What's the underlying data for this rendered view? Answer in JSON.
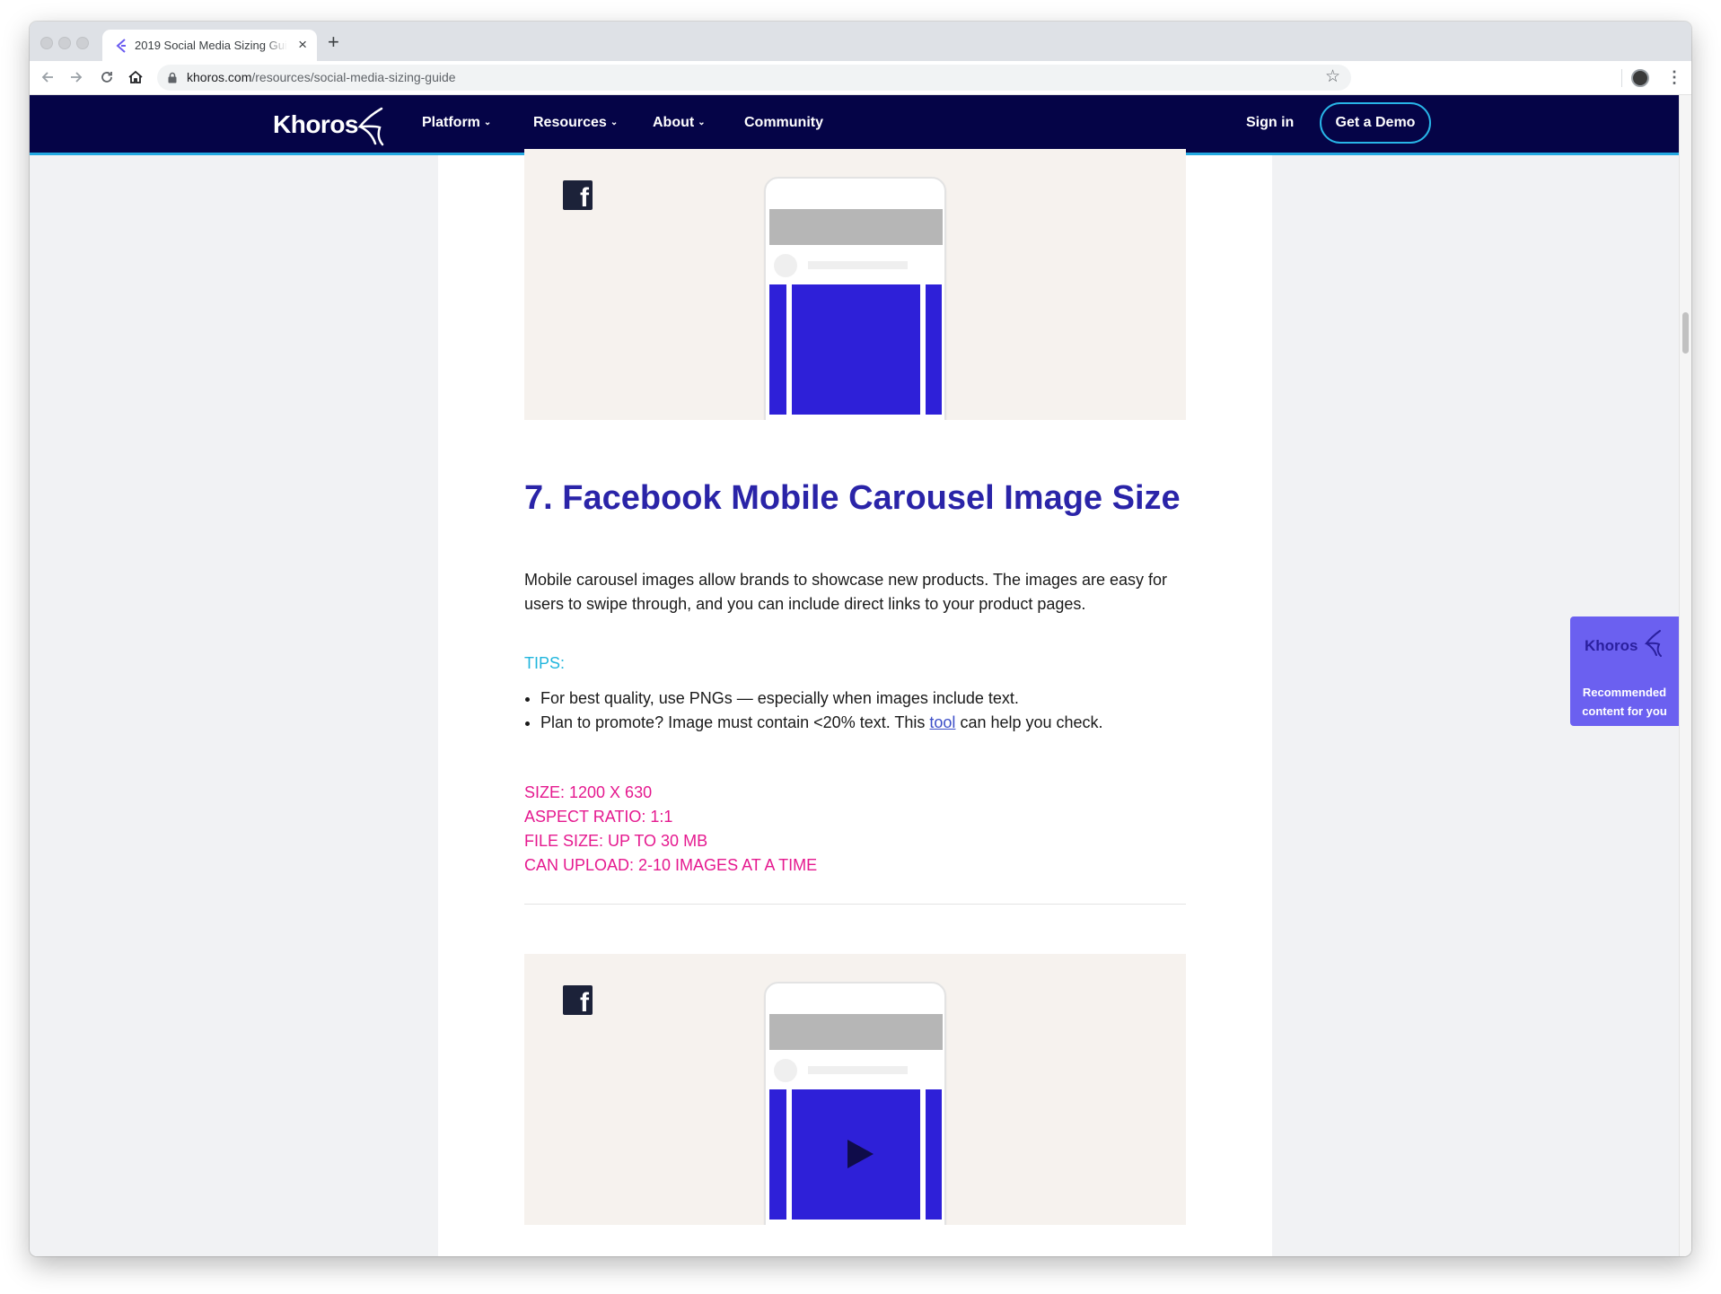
{
  "browser": {
    "tab_title": "2019 Social Media Sizing Guide",
    "tab_close": "×",
    "new_tab": "+",
    "url_domain": "khoros.com",
    "url_path": "/resources/social-media-sizing-guide"
  },
  "nav": {
    "brand": "Khoros",
    "items": [
      {
        "label": "Platform"
      },
      {
        "label": "Resources"
      },
      {
        "label": "About"
      },
      {
        "label": "Community"
      }
    ],
    "sign_in": "Sign in",
    "cta": "Get a Demo"
  },
  "article": {
    "heading": "7. Facebook Mobile Carousel Image Size",
    "intro": "Mobile carousel images allow brands to showcase new products. The images are easy for users to swipe through, and you can include direct links to your product pages.",
    "tips_label": "TIPS:",
    "tips": {
      "tip1": "For best quality, use PNGs — especially when images include text.",
      "tip2_before": "Plan to promote? Image must contain <20% text. This ",
      "tip2_link": "tool",
      "tip2_after": " can help you check."
    },
    "specs": [
      "SIZE: 1200 X 630",
      "ASPECT RATIO: 1:1",
      "FILE SIZE: UP TO 30 MB",
      "CAN UPLOAD: 2-10 IMAGES AT A TIME"
    ]
  },
  "widget": {
    "brand": "Khoros",
    "line1": "Recommended",
    "line2": "content for you"
  },
  "colors": {
    "nav_bg": "#050447",
    "heading": "#2a24a8",
    "tips": "#21b6dd",
    "specs": "#e5198f",
    "phone_media": "#2e20d8",
    "widget_bg": "#6b60f0"
  },
  "icons": [
    "back-icon",
    "forward-icon",
    "reload-icon",
    "home-icon",
    "lock-icon",
    "star-icon",
    "profile-icon",
    "menu-icon",
    "facebook-icon",
    "play-icon",
    "chevron-down-icon"
  ]
}
